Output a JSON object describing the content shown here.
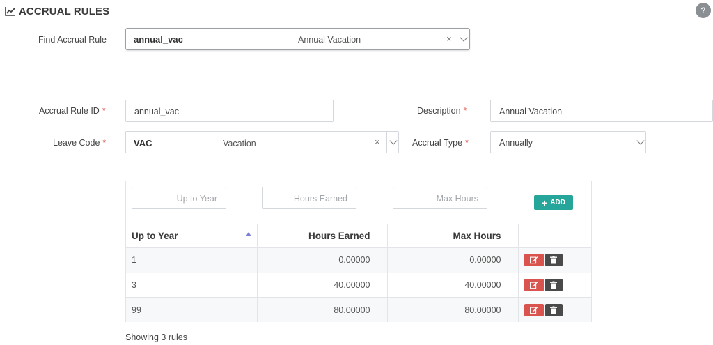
{
  "header": {
    "title": "ACCRUAL RULES",
    "icon": "line-chart-icon"
  },
  "help": {
    "label": "?"
  },
  "find": {
    "label": "Find Accrual Rule",
    "code": "annual_vac",
    "description": "Annual Vacation",
    "clear": "×"
  },
  "form": {
    "rule_id": {
      "label": "Accrual Rule ID",
      "required": "*",
      "value": "annual_vac"
    },
    "description": {
      "label": "Description",
      "required": "*",
      "value": "Annual Vacation"
    },
    "leave_code": {
      "label": "Leave Code",
      "required": "*",
      "code": "VAC",
      "name": "Vacation",
      "clear": "×"
    },
    "accrual_type": {
      "label": "Accrual Type",
      "required": "*",
      "value": "Annually"
    }
  },
  "filters": {
    "up_to_year": "Up to Year",
    "hours_earned": "Hours Earned",
    "max_hours": "Max Hours",
    "add_label": "ADD",
    "add_icon": "+"
  },
  "table": {
    "columns": [
      "Up to Year",
      "Hours Earned",
      "Max Hours",
      ""
    ],
    "rows": [
      {
        "year": "1",
        "earned": "0.00000",
        "max": "0.00000"
      },
      {
        "year": "3",
        "earned": "40.00000",
        "max": "40.00000"
      },
      {
        "year": "99",
        "earned": "80.00000",
        "max": "80.00000"
      }
    ]
  },
  "footer": {
    "showing": "Showing 3 rules"
  },
  "colors": {
    "accent": "#26a69a",
    "danger": "#d9534f",
    "dark": "#4a4a4a",
    "help": "#8a8f93"
  }
}
